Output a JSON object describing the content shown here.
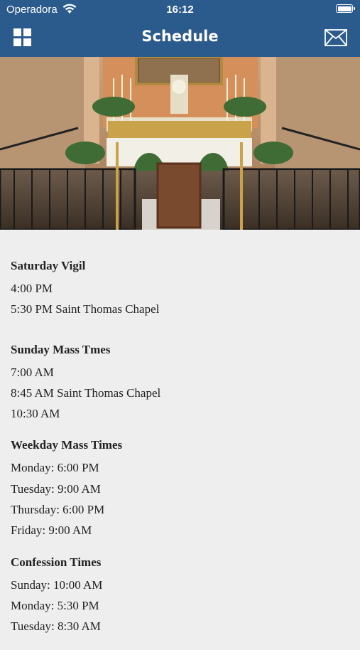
{
  "status_bar": {
    "carrier": "Operadora",
    "time": "16:12"
  },
  "nav": {
    "title": "Schedule",
    "menu_icon": "grid-icon",
    "mail_icon": "mail-icon",
    "bar_color": "#2b5a8c"
  },
  "schedule": [
    {
      "heading": "Saturday Vigil",
      "items": [
        "4:00 PM",
        "5:30 PM Saint Thomas Chapel"
      ]
    },
    {
      "heading": "Sunday Mass Tmes",
      "items": [
        "7:00 AM",
        "8:45 AM Saint Thomas Chapel",
        "10:30 AM"
      ]
    },
    {
      "heading": "Weekday Mass Times",
      "items": [
        "Monday: 6:00 PM",
        "Tuesday: 9:00 AM",
        "Thursday: 6:00 PM",
        "Friday: 9:00 AM"
      ]
    },
    {
      "heading": "Confession Times",
      "items": [
        "Sunday: 10:00 AM",
        "Monday: 5:30 PM",
        "Tuesday: 8:30 AM"
      ]
    }
  ]
}
